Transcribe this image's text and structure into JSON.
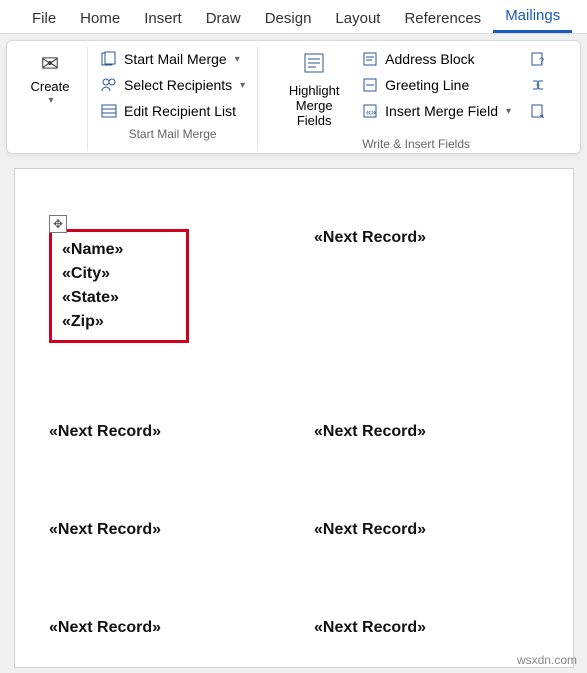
{
  "tabs": {
    "file": "File",
    "home": "Home",
    "insert": "Insert",
    "draw": "Draw",
    "design": "Design",
    "layout": "Layout",
    "references": "References",
    "mailings": "Mailings"
  },
  "ribbon": {
    "create": "Create",
    "create_group": "",
    "start_mail_merge": "Start Mail Merge",
    "select_recipients": "Select Recipients",
    "edit_recipient_list": "Edit Recipient List",
    "start_group": "Start Mail Merge",
    "highlight": "Highlight Merge Fields",
    "address_block": "Address Block",
    "greeting_line": "Greeting Line",
    "insert_merge_field": "Insert Merge Field",
    "write_insert_group": "Write & Insert Fields"
  },
  "doc": {
    "fields": {
      "name": "«Name»",
      "city": "«City»",
      "state": "«State»",
      "zip": "«Zip»"
    },
    "next_record": "«Next Record»"
  },
  "watermark": "wsxdn.com"
}
